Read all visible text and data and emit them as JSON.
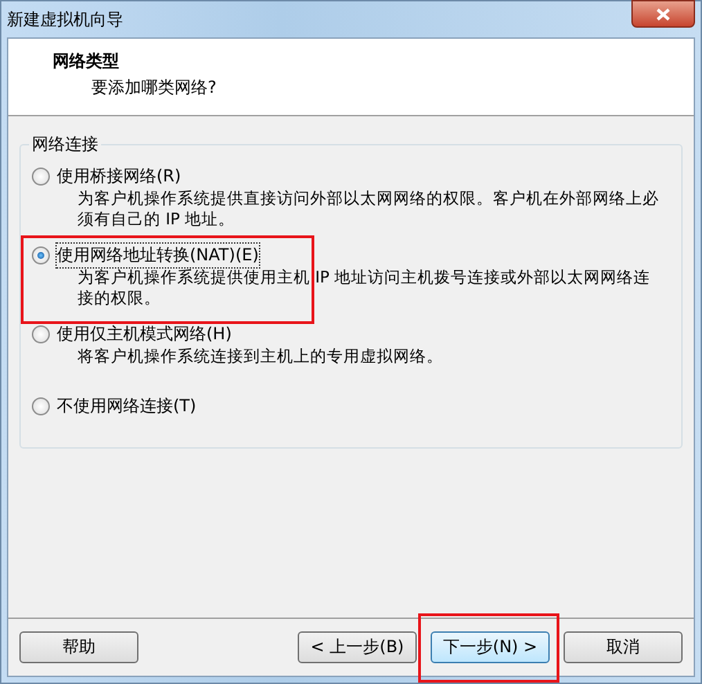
{
  "window": {
    "title": "新建虚拟机向导"
  },
  "header": {
    "title": "网络类型",
    "subtitle": "要添加哪类网络?"
  },
  "group": {
    "title": "网络连接",
    "options": [
      {
        "label": "使用桥接网络(R)",
        "description": "为客户机操作系统提供直接访问外部以太网网络的权限。客户机在外部网络上必须有自己的 IP 地址。",
        "selected": false,
        "highlighted": false
      },
      {
        "label": "使用网络地址转换(NAT)(E)",
        "description": "为客户机操作系统提供使用主机 IP 地址访问主机拨号连接或外部以太网网络连接的权限。",
        "selected": true,
        "highlighted": true
      },
      {
        "label": "使用仅主机模式网络(H)",
        "description": "将客户机操作系统连接到主机上的专用虚拟网络。",
        "selected": false,
        "highlighted": false
      },
      {
        "label": "不使用网络连接(T)",
        "selected": false,
        "highlighted": false
      }
    ]
  },
  "buttons": [
    {
      "label": "帮助",
      "kind": "left",
      "default": false,
      "highlighted": false
    },
    {
      "label": "< 上一步(B)",
      "kind": "right",
      "default": false,
      "highlighted": false
    },
    {
      "label": "下一步(N) >",
      "kind": "right",
      "default": true,
      "highlighted": true
    },
    {
      "label": "取消",
      "kind": "right",
      "default": false,
      "highlighted": false
    }
  ]
}
